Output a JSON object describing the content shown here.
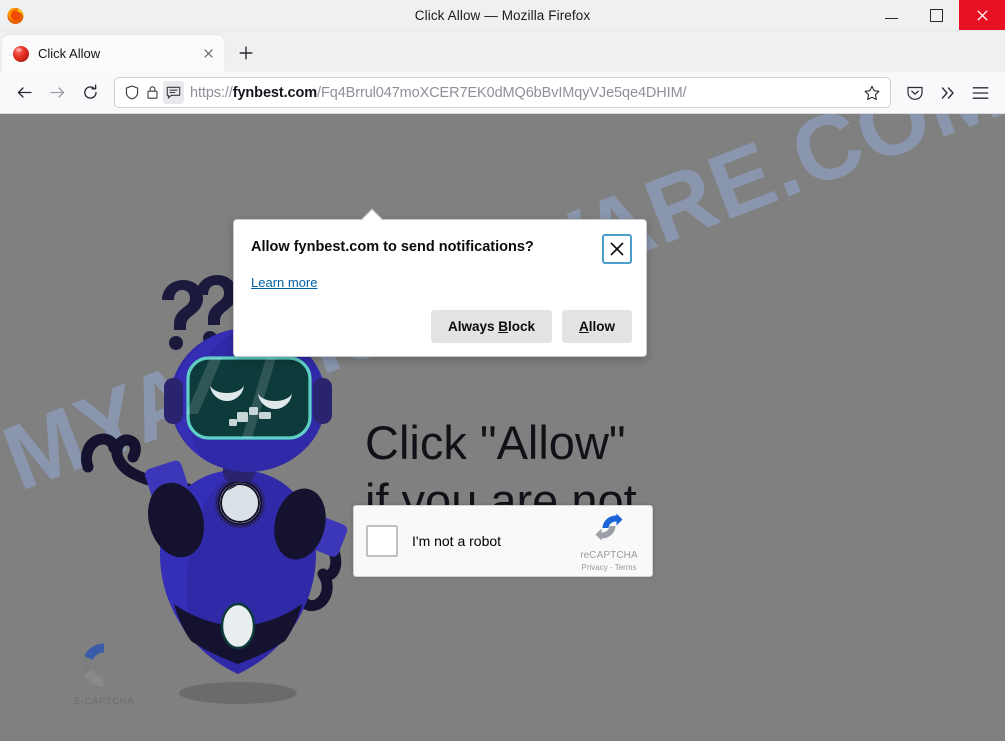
{
  "window": {
    "title": "Click Allow — Mozilla Firefox",
    "controls": {
      "minimize": "minimize",
      "maximize": "maximize",
      "close": "close"
    }
  },
  "tabbar": {
    "tabs": [
      {
        "title": "Click Allow",
        "close_label": "✕"
      }
    ],
    "new_tab_label": "+"
  },
  "toolbar": {
    "back_label": "←",
    "forward_label": "→",
    "reload_label": "⟳",
    "star_label": "☆",
    "pocket_label": "pocket",
    "overflow_label": "»",
    "menu_label": "☰"
  },
  "urlbar": {
    "scheme": "https://",
    "domain": "fynbest.com",
    "path": "/Fq4Brrul047moXCER7EK0dMQ6bBvIMqyVJe5qe4DHIM/",
    "full_url": "https://fynbest.com/Fq4Brrul047moXCER7EK0dMQ6bBvIMqyVJe5qe4DHIM/",
    "shield_icon": "shield-icon",
    "lock_icon": "padlock-icon",
    "notification_icon": "notification-permission-icon"
  },
  "doorhanger": {
    "title": "Allow fynbest.com to send notifications?",
    "learn_more": "Learn more",
    "close_label": "✕",
    "buttons": {
      "block_pre": "Always ",
      "block_key": "B",
      "block_post": "lock",
      "allow_key": "A",
      "allow_post": "llow"
    }
  },
  "page": {
    "headline_line1": "Click \"Allow\"",
    "headline_line2": "if you are not",
    "watermark": "MYANTISPYWARE.COM",
    "ecaptcha_label": "E-CAPTCHA",
    "recaptcha": {
      "checkbox_label": "I'm not a robot",
      "brand": "reCAPTCHA",
      "privacy": "Privacy",
      "separator": " - ",
      "terms": "Terms"
    }
  },
  "colors": {
    "page_background": "#808080",
    "accent_blue": "#0060a8",
    "close_red": "#e81123",
    "robot_body": "#3a35b0",
    "robot_visor": "#0d3b3b",
    "watermark": "#96b4eb"
  }
}
